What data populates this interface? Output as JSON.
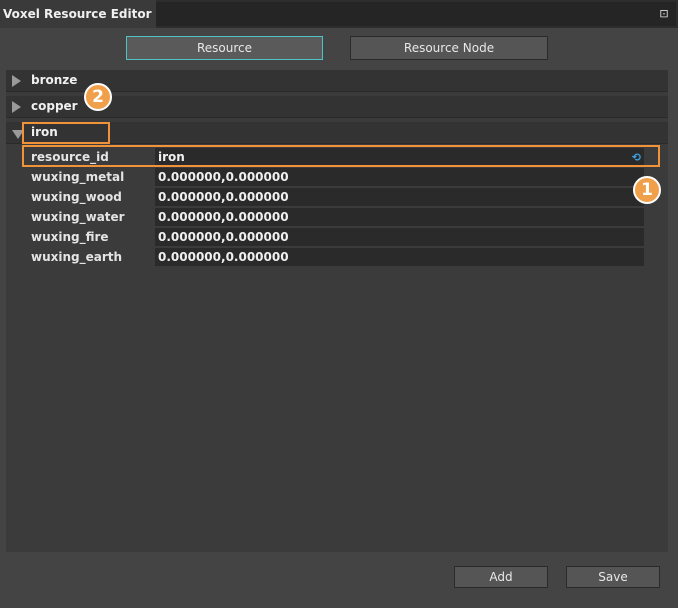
{
  "window": {
    "title": "Voxel Resource Editor"
  },
  "tabs": [
    {
      "label": "Resource",
      "active": true
    },
    {
      "label": "Resource Node",
      "active": false
    }
  ],
  "groups": [
    {
      "label": "bronze",
      "expanded": false
    },
    {
      "label": "copper",
      "expanded": false
    },
    {
      "label": "iron",
      "expanded": true
    }
  ],
  "properties": [
    {
      "key": "resource_id",
      "value": "iron"
    },
    {
      "key": "wuxing_metal",
      "value": "0.000000,0.000000"
    },
    {
      "key": "wuxing_wood",
      "value": "0.000000,0.000000"
    },
    {
      "key": "wuxing_water",
      "value": "0.000000,0.000000"
    },
    {
      "key": "wuxing_fire",
      "value": "0.000000,0.000000"
    },
    {
      "key": "wuxing_earth",
      "value": "0.000000,0.000000"
    }
  ],
  "annotations": {
    "badge1": "1",
    "badge2": "2"
  },
  "buttons": {
    "add": "Add",
    "save": "Save"
  },
  "colors": {
    "accent": "#4fc3c3",
    "highlight": "#f0923a",
    "badge": "#f0a04a",
    "reset_icon": "#3ea0e0"
  },
  "icons": {
    "dock": "dock-pin-icon",
    "reset": "reset-value-icon",
    "collapsed": "triangle-right-icon",
    "expanded": "triangle-down-icon"
  }
}
